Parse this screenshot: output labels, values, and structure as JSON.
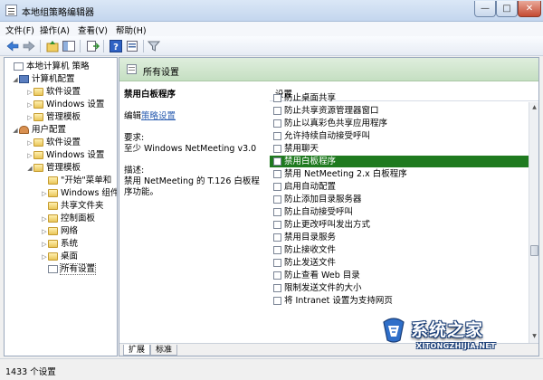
{
  "window": {
    "title": "本地组策略编辑器",
    "min": "—",
    "max": "□",
    "close": "✕"
  },
  "menu": [
    "文件(F)",
    "操作(A)",
    "查看(V)",
    "帮助(H)"
  ],
  "toolbar": [
    "back-icon",
    "forward-icon",
    "up-folder-icon",
    "show-tree-icon",
    "export-icon",
    "help-icon",
    "properties-icon",
    "filter-icon"
  ],
  "tree": [
    {
      "label": "本地计算机 策略",
      "icon": "policy",
      "exp": ""
    },
    {
      "label": "计算机配置",
      "icon": "pc",
      "exp": "◢"
    },
    {
      "label": "软件设置",
      "icon": "folder",
      "exp": "▷"
    },
    {
      "label": "Windows 设置",
      "icon": "folder",
      "exp": "▷"
    },
    {
      "label": "管理模板",
      "icon": "folder",
      "exp": "▷"
    },
    {
      "label": "用户配置",
      "icon": "usr",
      "exp": "◢"
    },
    {
      "label": "软件设置",
      "icon": "folder",
      "exp": "▷"
    },
    {
      "label": "Windows 设置",
      "icon": "folder",
      "exp": "▷"
    },
    {
      "label": "管理模板",
      "icon": "folder",
      "exp": "◢"
    },
    {
      "label": "\"开始\"菜单和",
      "icon": "folder",
      "exp": ""
    },
    {
      "label": "Windows 组件",
      "icon": "folder",
      "exp": "▷"
    },
    {
      "label": "共享文件夹",
      "icon": "folder",
      "exp": ""
    },
    {
      "label": "控制面板",
      "icon": "folder",
      "exp": "▷"
    },
    {
      "label": "网络",
      "icon": "folder",
      "exp": "▷"
    },
    {
      "label": "系统",
      "icon": "folder",
      "exp": "▷"
    },
    {
      "label": "桌面",
      "icon": "folder",
      "exp": "▷"
    },
    {
      "label": "所有设置",
      "icon": "policy",
      "exp": ""
    }
  ],
  "header": {
    "title": "所有设置"
  },
  "detail": {
    "title": "禁用白板程序",
    "edit_prefix": "编辑",
    "edit_link": "策略设置",
    "requirements_label": "要求:",
    "requirements_value": "至少 Windows NetMeeting v3.0",
    "description_label": "描述:",
    "description_value": "禁用 NetMeeting 的 T.126 白板程序功能。"
  },
  "list": {
    "column": "设置",
    "selected_index": 7,
    "items": [
      "防止桌面共享",
      "防止共享资源管理器窗口",
      "防止以真彩色共享应用程序",
      "允许持续自动接受呼叫",
      "禁用聊天",
      "禁用白板程序",
      "禁用 NetMeeting 2.x 白板程序",
      "启用自动配置",
      "防止添加目录服务器",
      "防止自动接受呼叫",
      "防止更改呼叫发出方式",
      "禁用目录服务",
      "防止接收文件",
      "防止发送文件",
      "防止查看 Web 目录",
      "限制发送文件的大小",
      "将 Intranet 设置为支持网页"
    ]
  },
  "tabs": [
    "扩展",
    "标准"
  ],
  "status": "1433 个设置",
  "watermark": {
    "name": "系统之家",
    "url": "XITONGZHIJIA.NET"
  },
  "colors": {
    "selection": "#1f7a1f",
    "header_band": "#c5dfc2",
    "link": "#2a5db0"
  }
}
